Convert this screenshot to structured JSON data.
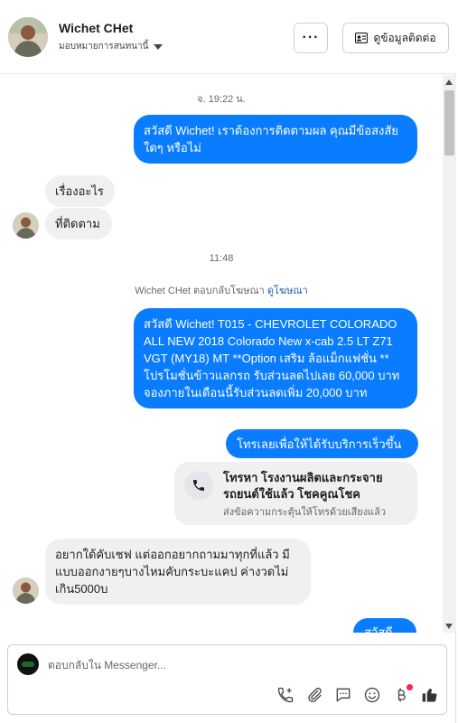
{
  "header": {
    "name": "Wichet CHet",
    "assign_label": "มอบหมายการสนทนานี้",
    "more_label": "···",
    "contact_button_label": "ดูข้อมูลติดต่อ"
  },
  "conversation": {
    "timestamp_1": "จ. 19:22 น.",
    "msg_out_1": "สวัสดี Wichet! เราต้องการติดตามผล คุณมีข้อสงสัยใดๆ หรือไม่",
    "msg_in_1": "เรื่องอะไร",
    "msg_in_2": "ที่ติดตาม",
    "timestamp_2": "11:48",
    "ad_reply_text": "Wichet CHet ตอบกลับโฆษณา",
    "ad_reply_link": "ดูโฆษณา",
    "msg_out_2": "สวัสดี Wichet! T015 - CHEVROLET COLORADO ALL NEW 2018 Colorado New x-cab 2.5 LT Z71 VGT (MY18) MT **Option เสริม ล้อแม็กแฟชั่น ** โปรโมชั่นข้าวแลกรถ รับส่วนลดไปเลย 60,000 บาท จองภายในเดือนนี้รับส่วนลดเพิ่ม 20,000 บาท",
    "msg_out_3": "โทรเลยเพื่อให้ได้รับบริการเร็วขึ้น",
    "call_card_title": "โทรหา โรงงานผลิตและกระจายรถยนต์ใช้แล้ว โชคคูณโชค",
    "call_card_subtitle": "ส่งข้อความกระตุ้นให้โทรด้วยเสียงแล้ว",
    "msg_in_3": "อยากใด้คับเชฟ  แต่ออกอยากถามมาทุกที่แล้ว มีแบบออกงายๆบางไหมคับกระบะแคป  ค่างวดไม่เกิน5000บ",
    "msg_out_4": "สวัสดีค่ะ"
  },
  "composer": {
    "placeholder": "ตอบกลับใน Messenger..."
  },
  "colors": {
    "outgoing_bubble": "#0a7cff",
    "incoming_bubble": "#f0f0f0",
    "link": "#1a5fb4"
  },
  "icons": [
    "more-options-icon",
    "contact-card-icon",
    "phone-icon",
    "add-call-icon",
    "attachment-icon",
    "saved-reply-icon",
    "emoji-icon",
    "payment-icon",
    "like-icon"
  ]
}
